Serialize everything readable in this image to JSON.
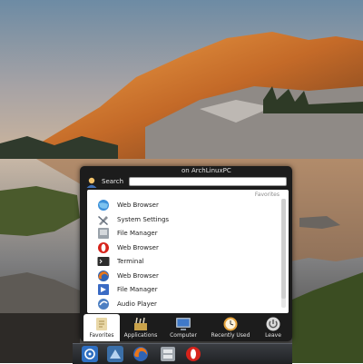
{
  "header": {
    "search_label": "Search",
    "search_value": "",
    "title_suffix": "on ArchLinuxPC"
  },
  "favorites": {
    "title": "Favorites",
    "items": [
      {
        "label": "Web Browser",
        "icon": "globe-icon"
      },
      {
        "label": "System Settings",
        "icon": "tools-icon"
      },
      {
        "label": "File Manager",
        "icon": "file-manager-icon"
      },
      {
        "label": "Web Browser",
        "icon": "opera-icon"
      },
      {
        "label": "Terminal",
        "icon": "terminal-icon"
      },
      {
        "label": "Web Browser",
        "icon": "firefox-icon"
      },
      {
        "label": "File Manager",
        "icon": "file-manager-icon"
      },
      {
        "label": "Audio Player",
        "icon": "audio-player-icon"
      }
    ]
  },
  "tabs": [
    {
      "label": "Favorites",
      "icon": "favorites-icon",
      "active": true
    },
    {
      "label": "Applications",
      "icon": "applications-icon",
      "active": false
    },
    {
      "label": "Computer",
      "icon": "computer-icon",
      "active": false
    },
    {
      "label": "Recently Used",
      "icon": "clock-icon",
      "active": false
    },
    {
      "label": "Leave",
      "icon": "power-icon",
      "active": false
    }
  ],
  "taskbar": {
    "items": [
      "kde-launcher-icon",
      "network-icon",
      "firefox-icon",
      "file-manager-icon",
      "opera-icon"
    ]
  },
  "colors": {
    "menu_bg": "#1c1c1c",
    "panel_bg": "#ffffff",
    "sky_top": "#6f8fa9",
    "sky_bottom": "#c7b29f"
  }
}
